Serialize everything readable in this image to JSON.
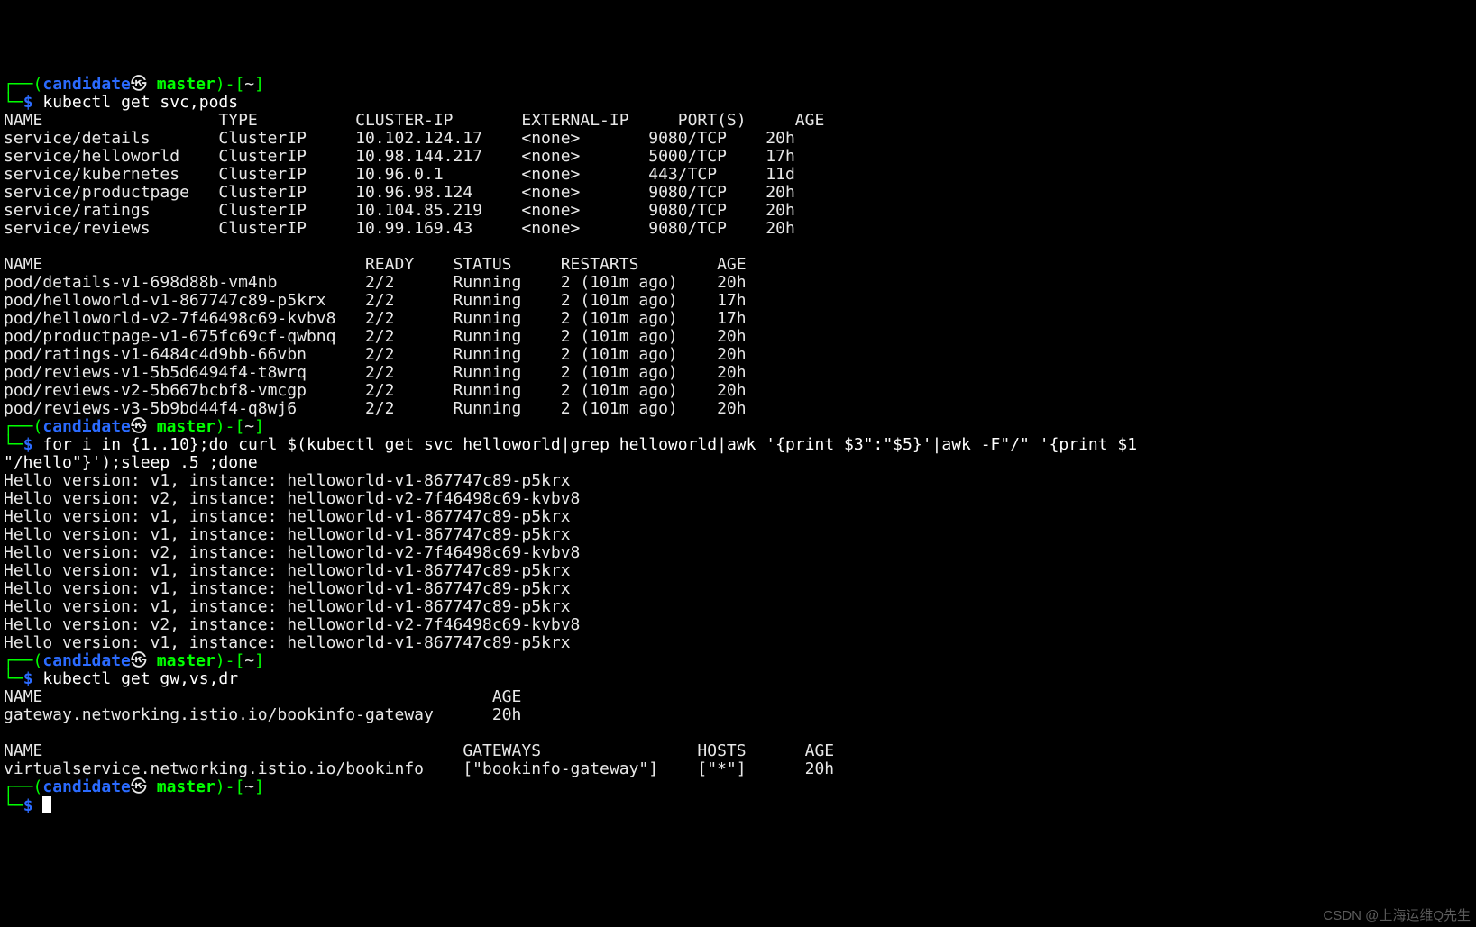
{
  "prompt": {
    "open": "┌──(",
    "host": "candidate",
    "star": "㉿",
    "branch": " master",
    "close": ")-[",
    "tilde": "~",
    "close2": "]",
    "line2open": "└─",
    "dollar": "$"
  },
  "commands": {
    "cmd1": " kubectl get svc,pods",
    "cmd2a": " for i in {1..10};do curl $(kubectl get svc helloworld|grep helloworld|awk '{print $3\":\"$5}'|awk -F\"/\" '{print $1",
    "cmd2b": "\"/hello\"}');sleep .5 ;done",
    "cmd3": " kubectl get gw,vs,dr",
    "cmd4": " "
  },
  "svc": {
    "hdr": {
      "name": "NAME",
      "type": "TYPE",
      "cip": "CLUSTER-IP",
      "eip": "EXTERNAL-IP",
      "ports": "PORT(S)",
      "age": "AGE"
    },
    "rows": [
      {
        "name": "service/details",
        "type": "ClusterIP",
        "cip": "10.102.124.17",
        "eip": "<none>",
        "ports": "9080/TCP",
        "age": "20h"
      },
      {
        "name": "service/helloworld",
        "type": "ClusterIP",
        "cip": "10.98.144.217",
        "eip": "<none>",
        "ports": "5000/TCP",
        "age": "17h"
      },
      {
        "name": "service/kubernetes",
        "type": "ClusterIP",
        "cip": "10.96.0.1",
        "eip": "<none>",
        "ports": "443/TCP",
        "age": "11d"
      },
      {
        "name": "service/productpage",
        "type": "ClusterIP",
        "cip": "10.96.98.124",
        "eip": "<none>",
        "ports": "9080/TCP",
        "age": "20h"
      },
      {
        "name": "service/ratings",
        "type": "ClusterIP",
        "cip": "10.104.85.219",
        "eip": "<none>",
        "ports": "9080/TCP",
        "age": "20h"
      },
      {
        "name": "service/reviews",
        "type": "ClusterIP",
        "cip": "10.99.169.43",
        "eip": "<none>",
        "ports": "9080/TCP",
        "age": "20h"
      }
    ]
  },
  "pods": {
    "hdr": {
      "name": "NAME",
      "ready": "READY",
      "status": "STATUS",
      "restarts": "RESTARTS",
      "age": "AGE"
    },
    "rows": [
      {
        "name": "pod/details-v1-698d88b-vm4nb",
        "ready": "2/2",
        "status": "Running",
        "restarts": "2 (101m ago)",
        "age": "20h"
      },
      {
        "name": "pod/helloworld-v1-867747c89-p5krx",
        "ready": "2/2",
        "status": "Running",
        "restarts": "2 (101m ago)",
        "age": "17h"
      },
      {
        "name": "pod/helloworld-v2-7f46498c69-kvbv8",
        "ready": "2/2",
        "status": "Running",
        "restarts": "2 (101m ago)",
        "age": "17h"
      },
      {
        "name": "pod/productpage-v1-675fc69cf-qwbnq",
        "ready": "2/2",
        "status": "Running",
        "restarts": "2 (101m ago)",
        "age": "20h"
      },
      {
        "name": "pod/ratings-v1-6484c4d9bb-66vbn",
        "ready": "2/2",
        "status": "Running",
        "restarts": "2 (101m ago)",
        "age": "20h"
      },
      {
        "name": "pod/reviews-v1-5b5d6494f4-t8wrq",
        "ready": "2/2",
        "status": "Running",
        "restarts": "2 (101m ago)",
        "age": "20h"
      },
      {
        "name": "pod/reviews-v2-5b667bcbf8-vmcgp",
        "ready": "2/2",
        "status": "Running",
        "restarts": "2 (101m ago)",
        "age": "20h"
      },
      {
        "name": "pod/reviews-v3-5b9bd44f4-q8wj6",
        "ready": "2/2",
        "status": "Running",
        "restarts": "2 (101m ago)",
        "age": "20h"
      }
    ]
  },
  "hello": {
    "lines": [
      "Hello version: v1, instance: helloworld-v1-867747c89-p5krx",
      "Hello version: v2, instance: helloworld-v2-7f46498c69-kvbv8",
      "Hello version: v1, instance: helloworld-v1-867747c89-p5krx",
      "Hello version: v1, instance: helloworld-v1-867747c89-p5krx",
      "Hello version: v2, instance: helloworld-v2-7f46498c69-kvbv8",
      "Hello version: v1, instance: helloworld-v1-867747c89-p5krx",
      "Hello version: v1, instance: helloworld-v1-867747c89-p5krx",
      "Hello version: v1, instance: helloworld-v1-867747c89-p5krx",
      "Hello version: v2, instance: helloworld-v2-7f46498c69-kvbv8",
      "Hello version: v1, instance: helloworld-v1-867747c89-p5krx"
    ]
  },
  "gw": {
    "hdr": {
      "name": "NAME",
      "age": "AGE"
    },
    "rows": [
      {
        "name": "gateway.networking.istio.io/bookinfo-gateway",
        "age": "20h"
      }
    ]
  },
  "vs": {
    "hdr": {
      "name": "NAME",
      "gateways": "GATEWAYS",
      "hosts": "HOSTS",
      "age": "AGE"
    },
    "rows": [
      {
        "name": "virtualservice.networking.istio.io/bookinfo",
        "gateways": "[\"bookinfo-gateway\"]",
        "hosts": "[\"*\"]",
        "age": "20h"
      }
    ]
  },
  "watermark": "CSDN @上海运维Q先生"
}
